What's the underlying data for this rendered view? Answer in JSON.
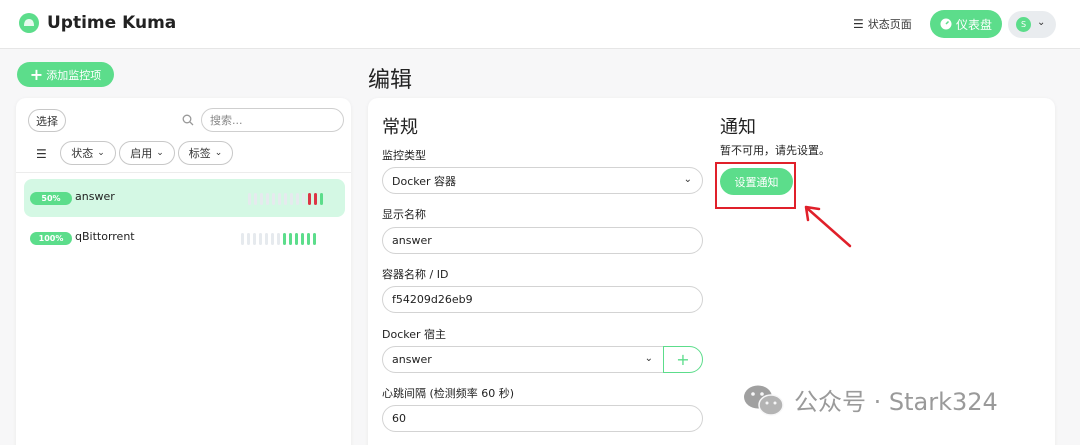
{
  "header": {
    "app_title": "Uptime Kuma",
    "status_page_label": "状态页面",
    "dashboard_label": "仪表盘",
    "avatar_initial": "S"
  },
  "toolbar": {
    "add_monitor_label": "添加监控项"
  },
  "page": {
    "title": "编辑"
  },
  "monitor_list": {
    "select_label": "选择",
    "search_placeholder": "搜索...",
    "filters": {
      "status": "状态",
      "active": "启用",
      "tags": "标签"
    },
    "items": [
      {
        "uptime": "50%",
        "name": "answer",
        "heartbeats": [
          "none",
          "none",
          "none",
          "none",
          "none",
          "none",
          "none",
          "none",
          "none",
          "none",
          "down",
          "down",
          "up"
        ]
      },
      {
        "uptime": "100%",
        "name": "qBittorrent",
        "heartbeats": [
          "none",
          "none",
          "none",
          "none",
          "none",
          "none",
          "none",
          "up",
          "up",
          "up",
          "up",
          "up",
          "up"
        ]
      }
    ]
  },
  "form": {
    "general_title": "常规",
    "monitor_type_label": "监控类型",
    "monitor_type_value": "Docker 容器",
    "display_name_label": "显示名称",
    "display_name_value": "answer",
    "container_label": "容器名称 / ID",
    "container_value": "f54209d26eb9",
    "docker_host_label": "Docker 宿主",
    "docker_host_value": "answer",
    "interval_label": "心跳间隔 (检测频率 60 秒)",
    "interval_value": "60"
  },
  "notifications": {
    "title": "通知",
    "notice": "暂不可用，请先设置。",
    "setup_label": "设置通知"
  },
  "watermark": {
    "text": "公众号 · Stark324"
  },
  "colors": {
    "accent": "#5cdd8b",
    "down": "#dc3545",
    "highlight": "#e0202a",
    "active_row": "#d4f8e4"
  }
}
